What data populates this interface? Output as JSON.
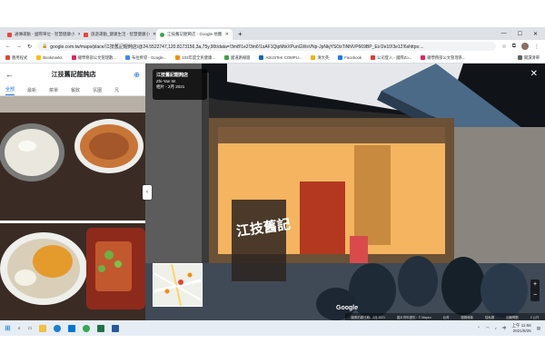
{
  "browser": {
    "tabs": [
      {
        "title": "通傳運動 - 國際單位 - 智慧健康小",
        "active": false
      },
      {
        "title": "旅遊運動_健康生活 - 智慧健康小",
        "active": false
      },
      {
        "title": "江技舊記餛飩店 - Google 地圖",
        "active": true
      }
    ],
    "new_tab": "+",
    "url": "google.com.tw/maps/place/江技舊記餛飩店/@24.5522747,120.8173156,3a,75y,90t/data=!3m8!1e2!3m6!1sAF1QipMtxXPunGWsVNp-JpNkjYSOsTiNNVP669BP_Eo!2e10!3e12!6shttps:..."
  },
  "bookmarks": [
    {
      "label": "應用程式"
    },
    {
      "label": "Bookmarks"
    },
    {
      "label": "總學務部公文管理數..."
    },
    {
      "label": "布拉齊導 - Google..."
    },
    {
      "label": "103年度全民健康..."
    },
    {
      "label": "國道路線圖"
    },
    {
      "label": "ASUSTeK COMPU..."
    },
    {
      "label": "清大英"
    },
    {
      "label": "Facebook"
    },
    {
      "label": "公司登入 - 國際Zo..."
    },
    {
      "label": "總學務部公文管理系..."
    }
  ],
  "bookmarks_right": "閱讀清單",
  "place_panel": {
    "title": "江技舊記餛飩店",
    "tabs": [
      "全部",
      "最新",
      "菜單",
      "餐飲",
      "氛圍",
      "凡"
    ],
    "active_tab": "全部"
  },
  "street_view": {
    "place_name": "江技舊記餛飩店",
    "uploader": "Zhi-Yan W.",
    "date": "相片 - 2月 2021",
    "logo": "Google",
    "footer": [
      "圖像拍攝日期：2月 2021",
      "圖片資料提供：© Mapeo",
      "台灣",
      "服務條款",
      "隱私權",
      "回報問題",
      "2 公尺"
    ],
    "sign_text": "江技舊記"
  },
  "taskbar": {
    "time": "上午 11:56",
    "date": "2021/8/25",
    "lang": "中",
    "colors": {
      "edge": "#1b7fd6",
      "explorer": "#f0c040",
      "word": "#2b579a",
      "excel": "#217346",
      "chrome": "#34a853",
      "store": "#0078d4"
    }
  }
}
